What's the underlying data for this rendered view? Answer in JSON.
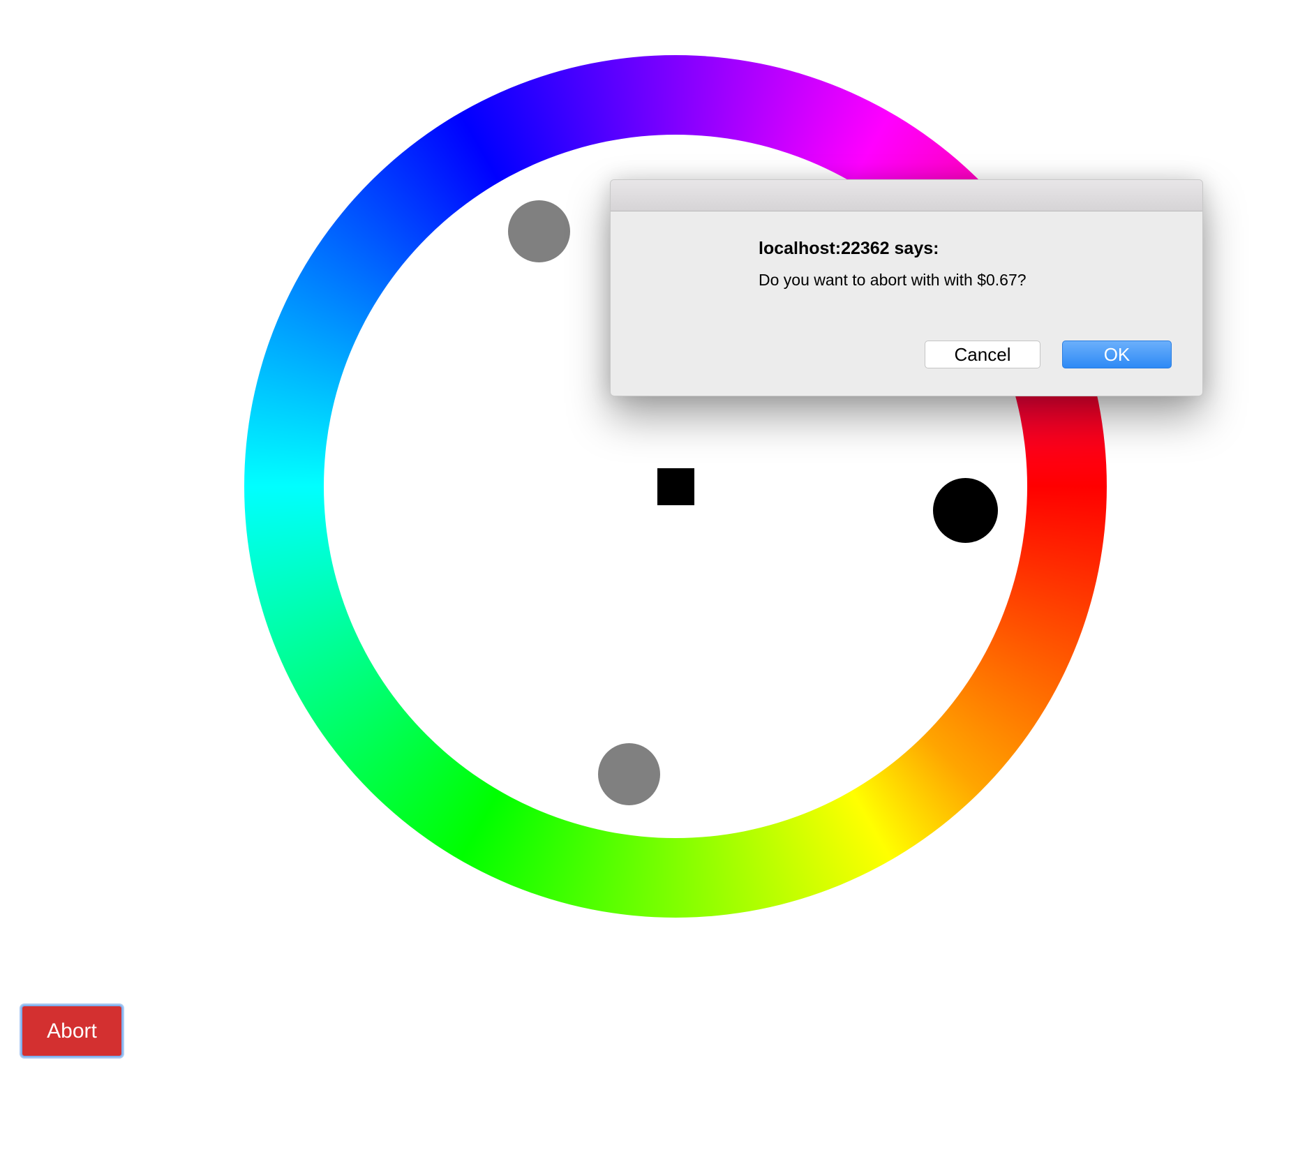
{
  "wheel": {
    "hue_ring_colors": [
      "#ff0000",
      "#ffa500",
      "#ffff00",
      "#00ff00",
      "#00ffff",
      "#0000ff",
      "#ff00ff"
    ],
    "center_square_color": "#000000",
    "marker_colors": {
      "gray": "#808080",
      "black": "#000000"
    }
  },
  "abort_button": {
    "label": "Abort",
    "color": "#d33030"
  },
  "dialog": {
    "title": "localhost:22362 says:",
    "message": "Do you want to abort with with $0.67?",
    "cancel_label": "Cancel",
    "ok_label": "OK",
    "ok_color": "#2e8af5"
  }
}
